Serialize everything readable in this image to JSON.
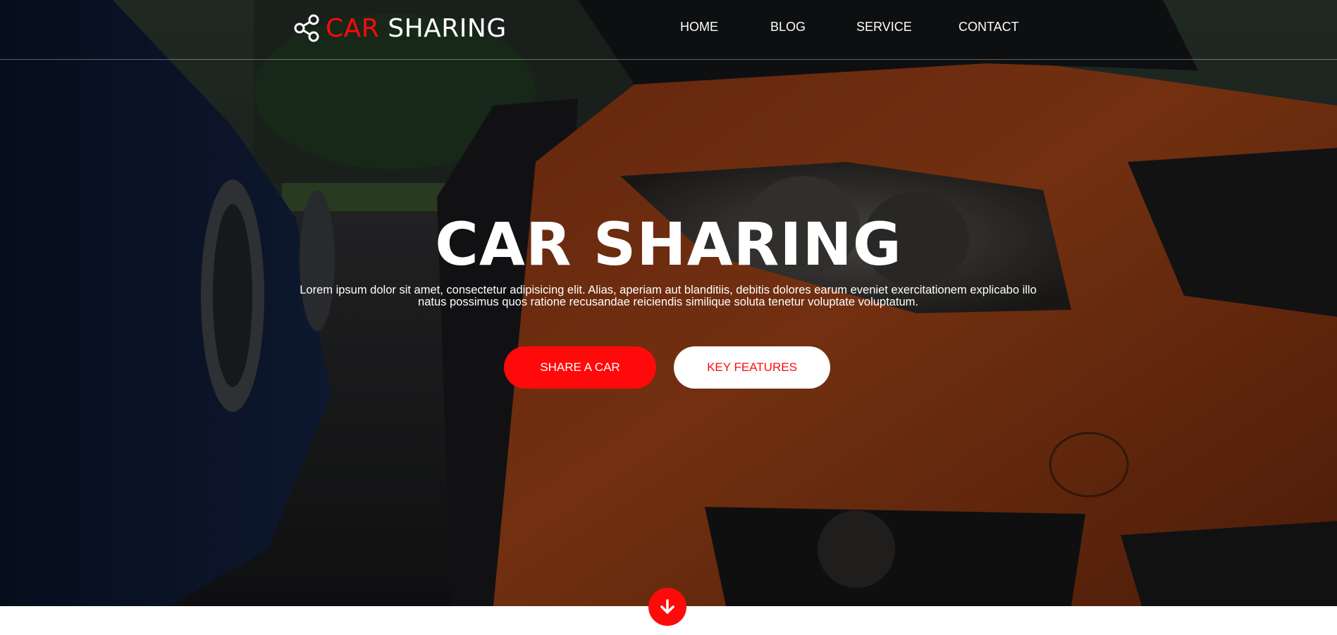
{
  "brand": {
    "name_accent": "CAR",
    "name_rest": "SHARING",
    "accent_color": "#ff0a0a",
    "icon": "share-icon"
  },
  "nav": {
    "items": [
      "HOME",
      "BLOG",
      "SERVICE",
      "CONTACT"
    ]
  },
  "hero": {
    "title": "CAR SHARING",
    "description": "Lorem ipsum dolor sit amet, consectetur adipisicing elit. Alias, aperiam aut blanditiis, debitis dolores earum eveniet exercitationem explicabo illo natus possimus quos ratione recusandae reiciendis similique soluta tenetur voluptate voluptatum.",
    "primary_button": "SHARE A CAR",
    "secondary_button": "KEY FEATURES",
    "scroll_icon": "arrow-down-icon"
  }
}
